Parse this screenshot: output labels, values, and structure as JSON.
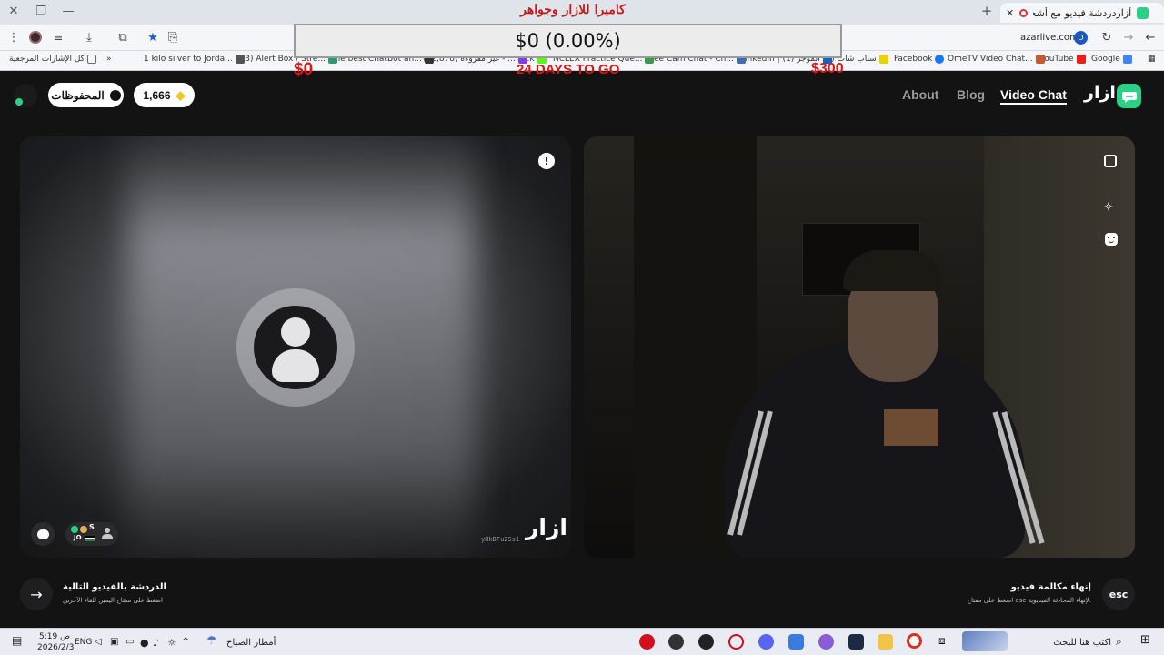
{
  "browser": {
    "tab_title": "أزاردردشة فيديو مع أشخاص",
    "url": "azarlive.com",
    "bookmarks": [
      {
        "label": "Google",
        "color": "#4285f4"
      },
      {
        "label": "YouTube",
        "color": "#e62117"
      },
      {
        "label": "OmeTV Video Chat...",
        "color": "#c75a2a"
      },
      {
        "label": "Facebook",
        "color": "#1877f2"
      },
      {
        "label": "(4) سناب شات",
        "color": "#e8d200"
      },
      {
        "label": "LinkedIn | (1) الموجز",
        "color": "#0a66c2"
      },
      {
        "label": "Free Cam Chat - Ch...",
        "color": "#3b6fb6"
      },
      {
        "label": "NCLEX Practice Que...",
        "color": "#3a9a4a"
      },
      {
        "label": "Kick",
        "color": "#53fc18"
      },
      {
        "label": "(22,878) غير مقروءة - ...",
        "color": "#7b3fe4"
      },
      {
        "label": "The best ChatBot an...",
        "color": "#333333"
      },
      {
        "label": "(33) Alert Box / Stre...",
        "color": "#2a9d6a"
      },
      {
        "label": "1 kilo silver to Jorda...",
        "color": "#555555"
      },
      {
        "label": "كل الإشارات المرجعية",
        "color": "#666666"
      }
    ]
  },
  "overlay": {
    "title": "كاميرا للازار وجواهر",
    "amount": "$0 (0.00%)",
    "left_amount": "$0",
    "right_amount": "$300",
    "countdown": "24 DAYS TO GO"
  },
  "nav": {
    "brand": "ازار",
    "links": {
      "video_chat": "Video Chat",
      "blog": "Blog",
      "about": "About"
    },
    "gems": "1,666",
    "saved": "المحفوظات"
  },
  "left_panel": {
    "watermark": "ازار",
    "user_id": "yHkDFu2Ss1",
    "partner_country": "JO",
    "partner_initial": "S"
  },
  "bottom": {
    "next_title": "الدردشة بالفيديو التالية",
    "next_hint": "اضغط على مفتاح اليمين للقاء الآخرين",
    "end_title": "إنهاء مكالمة فيديو",
    "end_hint": "اضغط على مفتاح esc لإنهاء المحادثة الفيديوية.",
    "esc_label": "esc"
  },
  "taskbar": {
    "search_placeholder": "اكتب هنا للبحث",
    "weather": "أمطار الصباح",
    "lang": "ENG",
    "time": "5:19 ص",
    "date": "2026/2/3"
  },
  "colors": {
    "brand_green": "#2ad185",
    "overlay_red": "#e01313",
    "page_bg": "#131313"
  }
}
